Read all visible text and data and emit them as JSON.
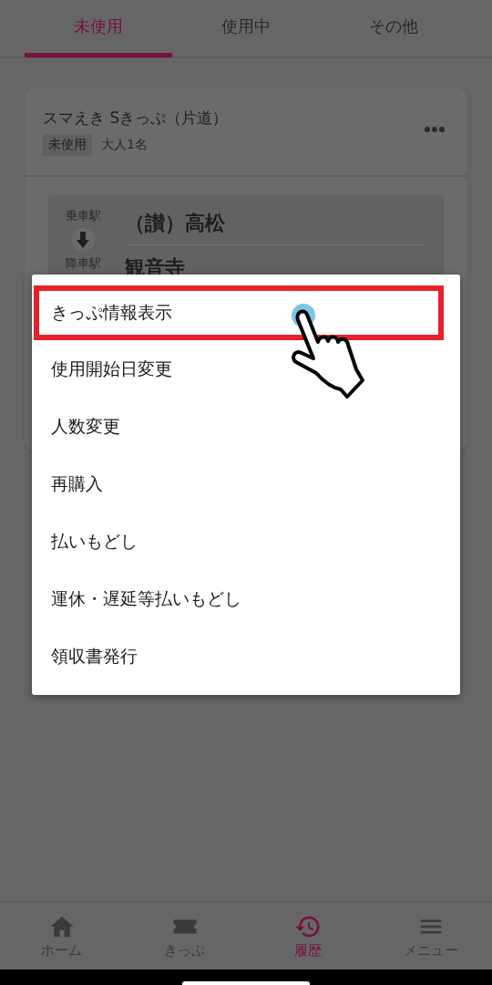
{
  "tabs": [
    {
      "label": "未使用",
      "selected": true
    },
    {
      "label": "使用中",
      "selected": false
    },
    {
      "label": "その他",
      "selected": false
    }
  ],
  "ticket": {
    "title": "スマえき Sきっぷ（片道）",
    "status": "未使用",
    "passengers": "大人1名",
    "boarding_label": "乗車駅",
    "boarding_station": "（讃）高松",
    "alighting_label": "降車駅",
    "alighting_station": "観音寺"
  },
  "menu": {
    "items": [
      {
        "label": "きっぷ情報表示",
        "highlighted": true
      },
      {
        "label": "使用開始日変更",
        "highlighted": false
      },
      {
        "label": "人数変更",
        "highlighted": false
      },
      {
        "label": "再購入",
        "highlighted": false
      },
      {
        "label": "払いもどし",
        "highlighted": false
      },
      {
        "label": "運休・遅延等払いもどし",
        "highlighted": false
      },
      {
        "label": "領収書発行",
        "highlighted": false
      }
    ]
  },
  "bottom_nav": [
    {
      "label": "ホーム",
      "kind": "home",
      "selected": false
    },
    {
      "label": "きっぷ",
      "kind": "ticket",
      "selected": false
    },
    {
      "label": "履歴",
      "kind": "history",
      "selected": true
    },
    {
      "label": "メニュー",
      "kind": "menu",
      "selected": false
    }
  ]
}
